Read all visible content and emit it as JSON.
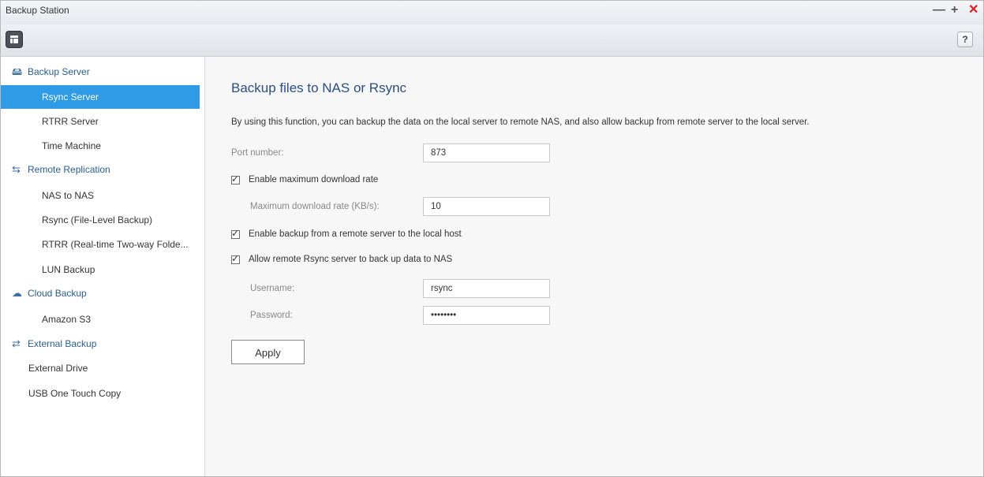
{
  "window": {
    "title": "Backup Station",
    "controls": {
      "minimize": "—",
      "maximize": "+",
      "close": "✕"
    }
  },
  "toolbar": {
    "menu_icon": "app-menu-icon",
    "help_label": "?"
  },
  "sidebar": {
    "groups": [
      {
        "label": "Backup Server",
        "icon": "server-icon",
        "icon_glyph": "🖴",
        "items": [
          {
            "label": "Rsync Server",
            "active": true
          },
          {
            "label": "RTRR Server"
          },
          {
            "label": "Time Machine"
          }
        ]
      },
      {
        "label": "Remote Replication",
        "icon": "replication-icon",
        "icon_glyph": "⇆",
        "items": [
          {
            "label": "NAS to NAS"
          },
          {
            "label": "Rsync (File-Level Backup)"
          },
          {
            "label": "RTRR (Real-time Two-way Folde..."
          },
          {
            "label": "LUN Backup"
          }
        ]
      },
      {
        "label": "Cloud Backup",
        "icon": "cloud-icon",
        "icon_glyph": "☁",
        "items": [
          {
            "label": "Amazon S3"
          }
        ]
      },
      {
        "label": "External Backup",
        "icon": "sync-arrows-icon",
        "icon_glyph": "⇄",
        "items": [
          {
            "label": "External Drive"
          },
          {
            "label": "USB One Touch Copy"
          }
        ]
      }
    ]
  },
  "main": {
    "title": "Backup files to NAS or Rsync",
    "description": "By using this function, you can backup the data on the local server to remote NAS, and also allow backup from remote server to the local server.",
    "port": {
      "label": "Port number:",
      "value": "873"
    },
    "enable_max_rate": {
      "label": "Enable maximum download rate",
      "checked": true
    },
    "max_rate": {
      "label": "Maximum download rate (KB/s):",
      "value": "10"
    },
    "enable_remote_backup": {
      "label": "Enable backup from a remote server to the local host",
      "checked": true
    },
    "allow_remote_rsync": {
      "label": "Allow remote Rsync server to back up data to NAS",
      "checked": true
    },
    "username": {
      "label": "Username:",
      "value": "rsync"
    },
    "password": {
      "label": "Password:",
      "value": "••••••••"
    },
    "apply_label": "Apply"
  },
  "colors": {
    "active_item_bg": "#2f9be6",
    "group_text": "#2a5d8f",
    "title_text": "#2a4e82",
    "close_button": "#e02020"
  }
}
